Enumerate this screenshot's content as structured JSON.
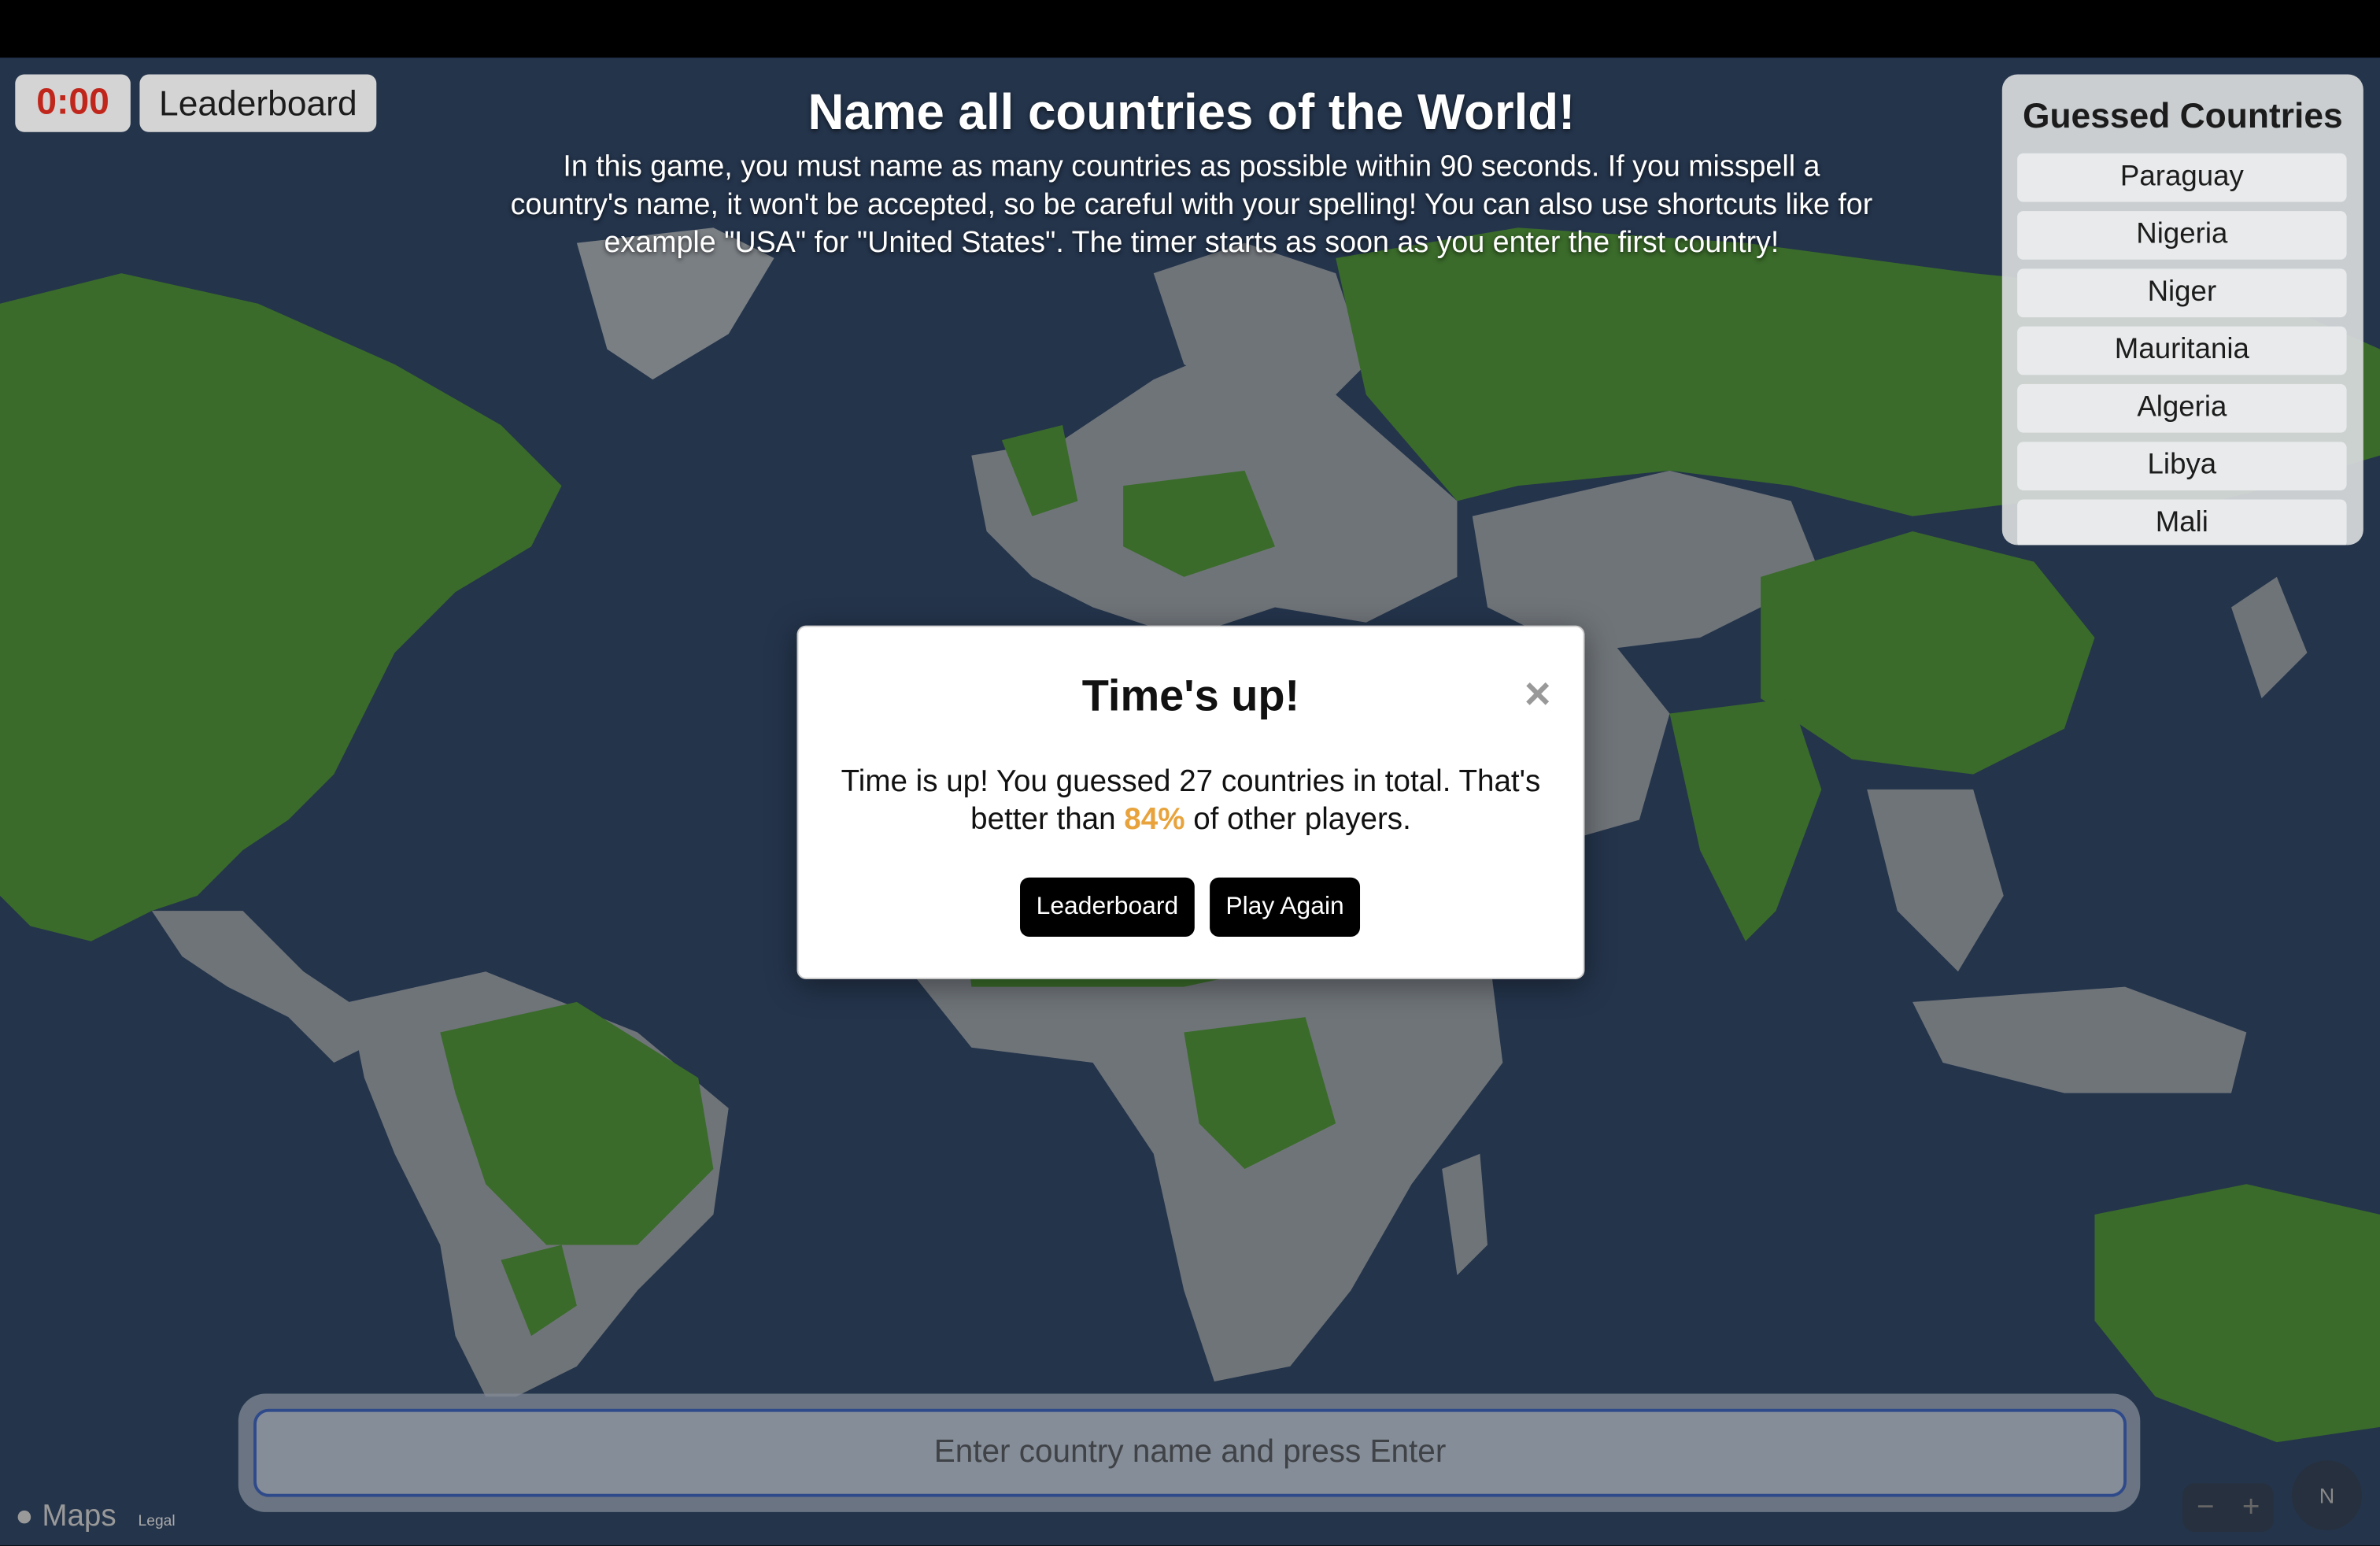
{
  "timer": "0:00",
  "header": {
    "leaderboard_label": "Leaderboard",
    "title": "Name all countries of the World!",
    "description": "In this game, you must name as many countries as possible within 90 seconds. If you misspell a country's name, it won't be accepted, so be careful with your spelling! You can also use shortcuts like for example \"USA\" for \"United States\". The timer starts as soon as you enter the first country!"
  },
  "guessed": {
    "title": "Guessed Countries",
    "items": [
      "Paraguay",
      "Nigeria",
      "Niger",
      "Mauritania",
      "Algeria",
      "Libya",
      "Mali"
    ]
  },
  "modal": {
    "title": "Time's up!",
    "close_symbol": "×",
    "message_before": "Time is up! You guessed 27 countries in total. That's better than ",
    "percent": "84%",
    "message_after": " of other players.",
    "leaderboard_label": "Leaderboard",
    "play_again_label": "Play Again"
  },
  "input": {
    "placeholder": "Enter country name and press Enter"
  },
  "map": {
    "brand": "Maps",
    "legal": "Legal",
    "zoom_out": "−",
    "zoom_in": "+",
    "compass": "N"
  },
  "colors": {
    "ocean": "#24344b",
    "land": "#6f7479",
    "guessed_land": "#3a6b2a",
    "timer_text": "#c0261b",
    "percent": "#e8a33c"
  }
}
